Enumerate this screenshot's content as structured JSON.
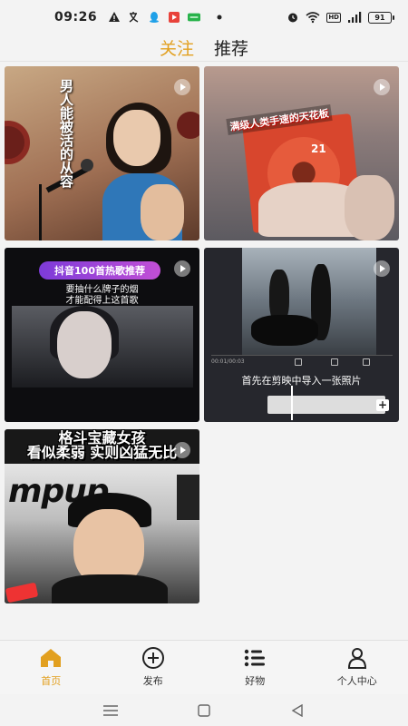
{
  "status_bar": {
    "time": "09:26",
    "battery": "91",
    "hd_label": "HD",
    "left_icons": [
      "warning-icon",
      "translate-icon",
      "qq-icon",
      "app-red-icon",
      "app-green-icon",
      "dot-icon"
    ],
    "right_icons": [
      "alarm-icon",
      "wifi-icon",
      "hd-icon",
      "signal-icon",
      "battery-icon"
    ]
  },
  "top_tabs": [
    {
      "label": "关注",
      "active": true
    },
    {
      "label": "推荐",
      "active": false
    }
  ],
  "feed": {
    "cards": [
      {
        "overlay_text": "男人能被活的从容"
      },
      {
        "overlay_text": "满级人类手速的天花板",
        "number": "21"
      },
      {
        "overlay_title": "抖音100首热歌推荐",
        "overlay_sub1": "要抽什么牌子的烟",
        "overlay_sub2": "才能配得上这首歌"
      },
      {
        "timestamp": "00:01/00:03",
        "caption": "首先在剪映中导入一张照片"
      },
      {
        "overlay_line1": "格斗宝藏女孩",
        "overlay_line2": "看似柔弱 实则凶猛无比",
        "logo_text": "mpup"
      }
    ]
  },
  "bottom_nav": [
    {
      "label": "首页",
      "icon": "home-icon",
      "active": true
    },
    {
      "label": "发布",
      "icon": "add-circle-icon",
      "active": false
    },
    {
      "label": "好物",
      "icon": "list-icon",
      "active": false
    },
    {
      "label": "个人中心",
      "icon": "person-icon",
      "active": false
    }
  ],
  "colors": {
    "accent": "#e2a020",
    "background": "#f3f3f3"
  },
  "system_nav": {
    "icons": [
      "menu-icon",
      "home-square-icon",
      "back-triangle-icon"
    ]
  }
}
